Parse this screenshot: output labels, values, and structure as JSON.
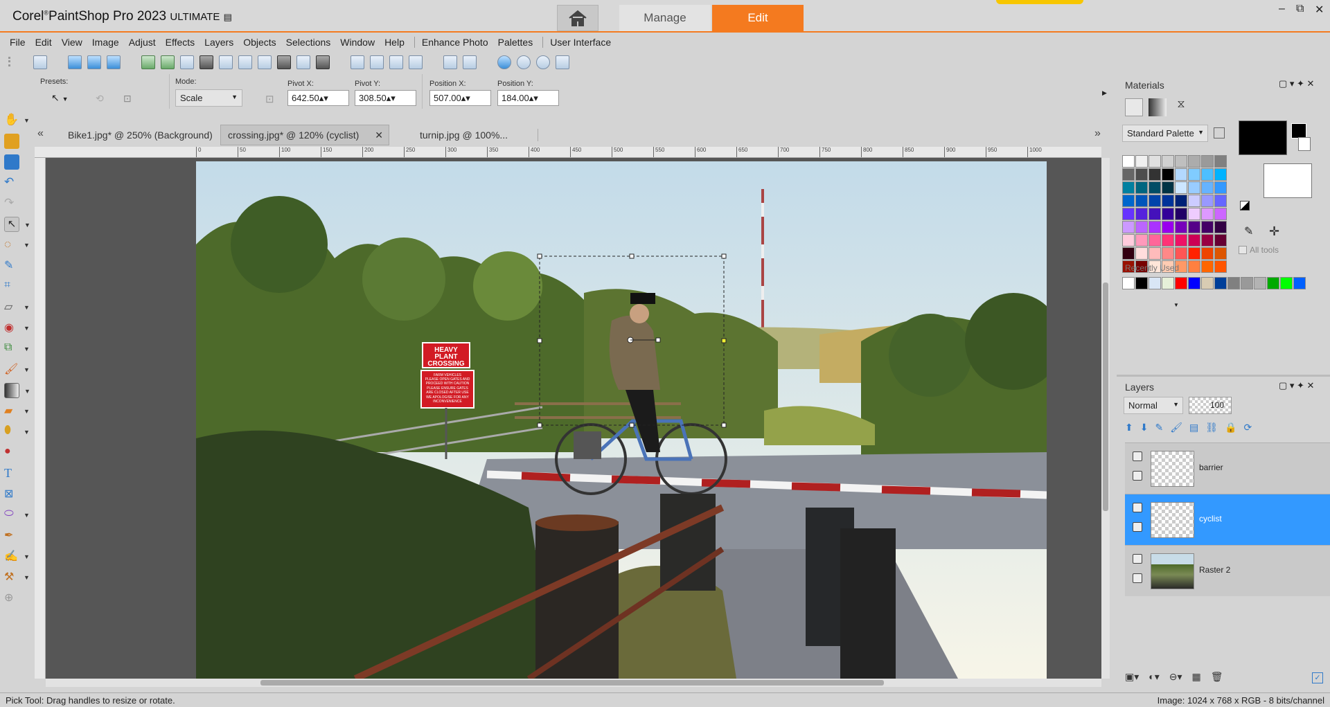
{
  "window": {
    "app_brand": "Corel",
    "app_name": "PaintShop Pro 2023",
    "edition": "ULTIMATE",
    "manage_label": "Manage",
    "edit_label": "Edit",
    "minimize": "–",
    "restore": "⧉",
    "close": "✕"
  },
  "menu": [
    "File",
    "Edit",
    "View",
    "Image",
    "Adjust",
    "Effects",
    "Layers",
    "Objects",
    "Selections",
    "Window",
    "Help",
    "Enhance Photo",
    "Palettes",
    "User Interface"
  ],
  "options": {
    "presets_label": "Presets:",
    "mode_label": "Mode:",
    "mode_value": "Scale",
    "pivot_x_label": "Pivot X:",
    "pivot_x": "642.50",
    "pivot_y_label": "Pivot Y:",
    "pivot_y": "308.50",
    "position_x_label": "Position X:",
    "position_x": "507.00",
    "position_y_label": "Position Y:",
    "position_y": "184.00"
  },
  "tabs": [
    {
      "label": "Bike1.jpg* @ 250% (Background)"
    },
    {
      "label": "crossing.jpg* @ 120% (cyclist)"
    },
    {
      "label": "turnip.jpg @ 100%..."
    }
  ],
  "ruler_ticks": [
    "0",
    "50",
    "100",
    "150",
    "200",
    "250",
    "300",
    "350",
    "400",
    "450",
    "500",
    "550",
    "600",
    "650",
    "700",
    "750",
    "800",
    "850",
    "900",
    "950",
    "1000"
  ],
  "photo_sign": {
    "line1": "HEAVY",
    "line2": "PLANT",
    "line3": "CROSSING",
    "small1": "FARM VEHICLES",
    "small2": "PLEASE OPEN GATES AND",
    "small3": "PROCEED WITH CAUTION",
    "small4": "PLEASE ENSURE GATES",
    "small5": "ARE CLOSED AFTER USE",
    "small6": "WE APOLOGISE FOR ANY",
    "small7": "INCONVENIENCE"
  },
  "materials": {
    "title": "Materials",
    "palette_select": "Standard Palette",
    "recent_label": "Recently Used",
    "all_tools_label": "All tools",
    "foreground_color": "#000000",
    "background_color": "#ffffff",
    "recent_colors": [
      "#ffffff",
      "#000000",
      "#d9e6f5",
      "#e6f0d9",
      "#ff0000",
      "#0000ff",
      "#d9ccb3",
      "#003f99",
      "#808080",
      "#999999",
      "#b3b3b3",
      "#00aa00",
      "#00ff00",
      "#0060ff"
    ]
  },
  "layers": {
    "title": "Layers",
    "blend_mode": "Normal",
    "opacity": "100",
    "items": [
      {
        "name": "barrier",
        "selected": false
      },
      {
        "name": "cyclist",
        "selected": true
      },
      {
        "name": "Raster 2",
        "selected": false
      }
    ]
  },
  "status": {
    "left": "Pick Tool: Drag handles to resize or rotate.",
    "right": "Image:  1024 x 768 x RGB - 8 bits/channel"
  },
  "colors": {
    "accent": "#f47a1f",
    "layer_selected": "#3399ff"
  }
}
